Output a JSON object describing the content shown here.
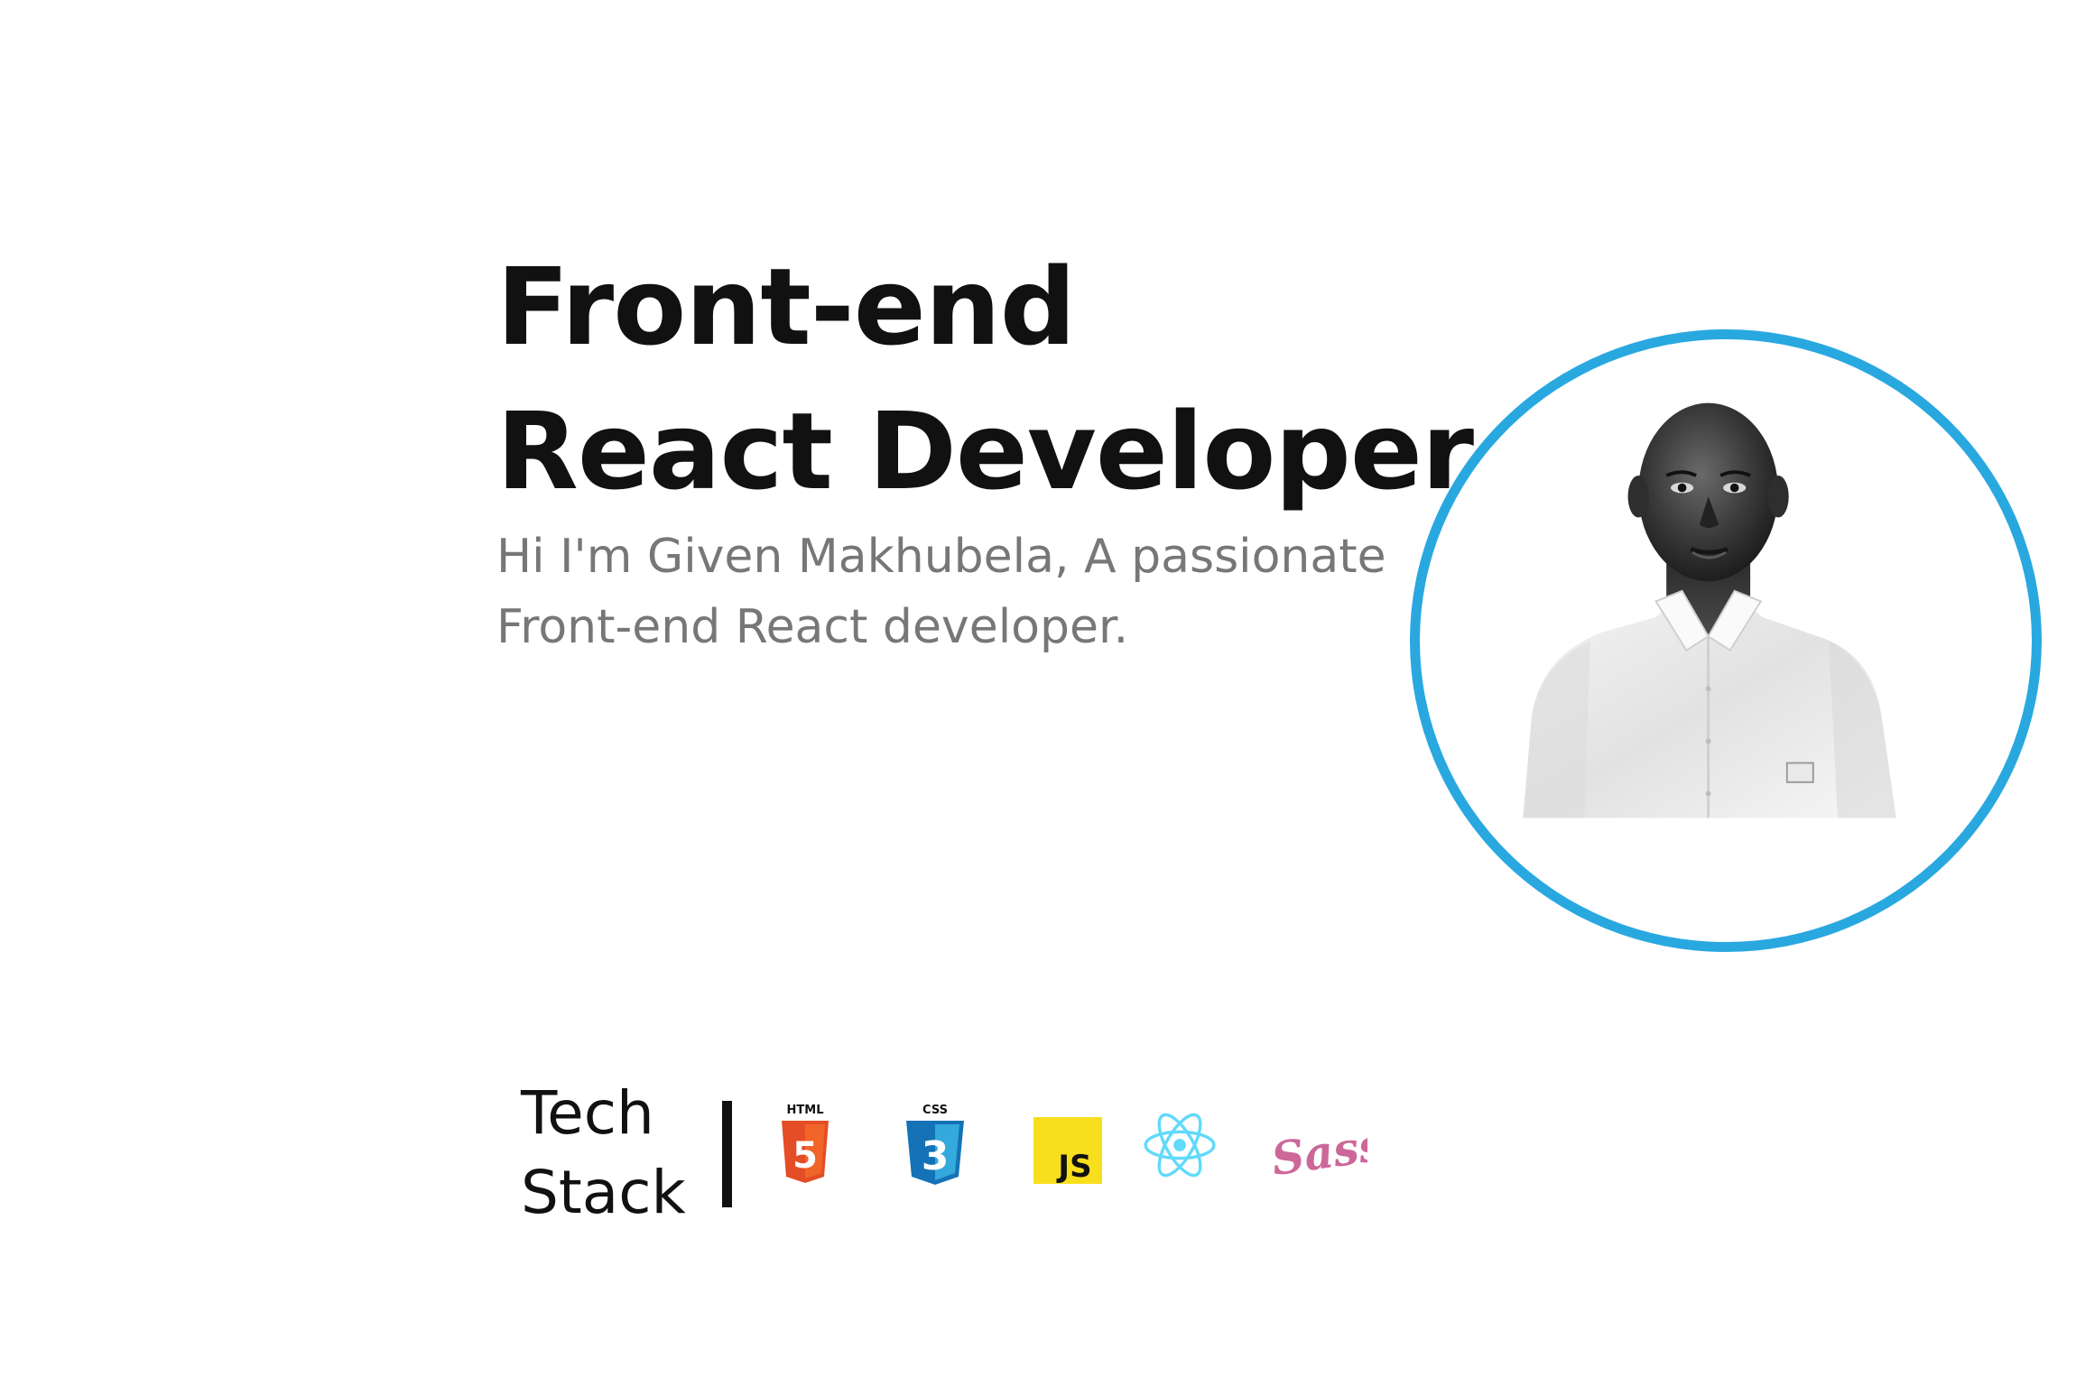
{
  "hero": {
    "headline_line1": "Front-end",
    "headline_line2": "React Developer",
    "intro_line1": "Hi I'm Given Makhubela, A passionate",
    "intro_line2": "Front-end React developer."
  },
  "avatar": {
    "ring_color": "#29a8e0"
  },
  "tech_stack": {
    "label_line1": "Tech",
    "label_line2": "Stack",
    "icons": {
      "html": {
        "name": "html5-icon",
        "caption": "HTML",
        "glyph": "5",
        "color": "#e44d26"
      },
      "css": {
        "name": "css3-icon",
        "caption": "CSS",
        "glyph": "3",
        "color": "#1572b6"
      },
      "js": {
        "name": "javascript-icon",
        "glyph": "JS",
        "color": "#f7df1e"
      },
      "react": {
        "name": "react-icon",
        "color": "#61dafb"
      },
      "sass": {
        "name": "sass-icon",
        "glyph": "Sass",
        "color": "#cd6799"
      }
    }
  }
}
